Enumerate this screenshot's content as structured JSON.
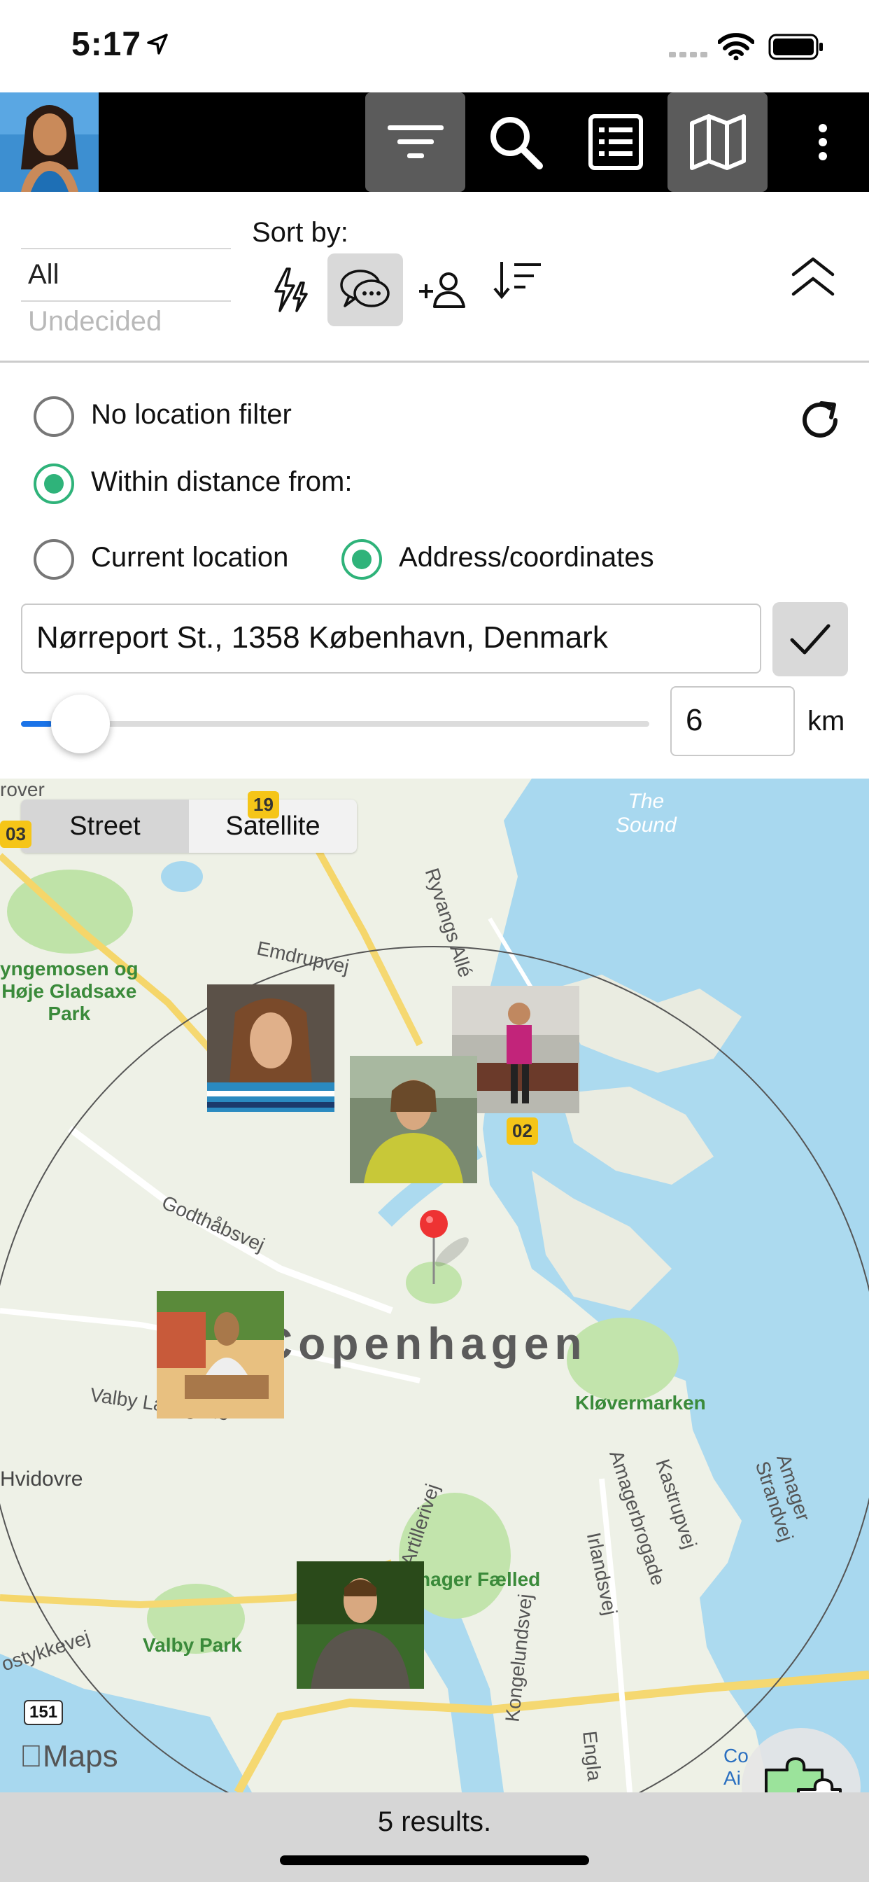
{
  "status_bar": {
    "time": "5:17",
    "icons": [
      "location-arrow-icon",
      "signal-icon",
      "wifi-icon",
      "battery-icon"
    ]
  },
  "toolbar": {
    "buttons": [
      {
        "name": "filter",
        "icon": "filter-icon",
        "active": true
      },
      {
        "name": "search",
        "icon": "search-icon",
        "active": false
      },
      {
        "name": "list",
        "icon": "list-icon",
        "active": false
      },
      {
        "name": "map",
        "icon": "map-icon",
        "active": true
      },
      {
        "name": "more",
        "icon": "more-vertical-icon",
        "active": false
      }
    ]
  },
  "sort": {
    "picker_selected": "All",
    "picker_next": "Undecided",
    "label": "Sort by:",
    "options": [
      {
        "icon": "activity-icon",
        "active": false
      },
      {
        "icon": "chat-icon",
        "active": true
      },
      {
        "icon": "add-person-icon",
        "active": false
      },
      {
        "icon": "sort-descending-icon",
        "active": false
      }
    ],
    "collapse_icon": "chevron-double-up-icon"
  },
  "location_filter": {
    "no_filter_label": "No location filter",
    "no_filter_selected": false,
    "within_label": "Within distance from:",
    "within_selected": true,
    "current_location_label": "Current location",
    "current_location_selected": false,
    "address_label": "Address/coordinates",
    "address_selected": true,
    "address_value": "Nørreport St., 1358 København, Denmark",
    "distance_value": "6",
    "distance_unit": "km",
    "slider_fraction": 0.05
  },
  "map": {
    "mode_options": [
      "Street",
      "Satellite"
    ],
    "selected_mode": "Street",
    "labels": {
      "sea": "The\nSound",
      "city": "Copenhagen",
      "park1": "Kløvermarken",
      "park2": "Amager Fælled",
      "park3": "Valby Park",
      "area1": "Hvidovre",
      "area2": "yngemosen og\nHøje Gladsaxe\nPark",
      "road1": "Emdrupvej",
      "road2": "Ryvangs Allé",
      "road3": "Godthåbsvej",
      "road4": "Valby Langgade",
      "road5": "Artillerivej",
      "road6": "Amagerbrogade",
      "road7": "Kastrupvej",
      "road8": "Irlandsvej",
      "road9": "Amager Strandvej",
      "road10": "Kongelundsvej",
      "road11": "ostykkevej",
      "road12": "rover",
      "road13": "Engla",
      "airport": "Co\nAi"
    },
    "shields": [
      "19",
      "03",
      "02",
      "151"
    ],
    "brand": "Maps",
    "result_count": 5
  },
  "footer": {
    "results_text": "5 results."
  }
}
